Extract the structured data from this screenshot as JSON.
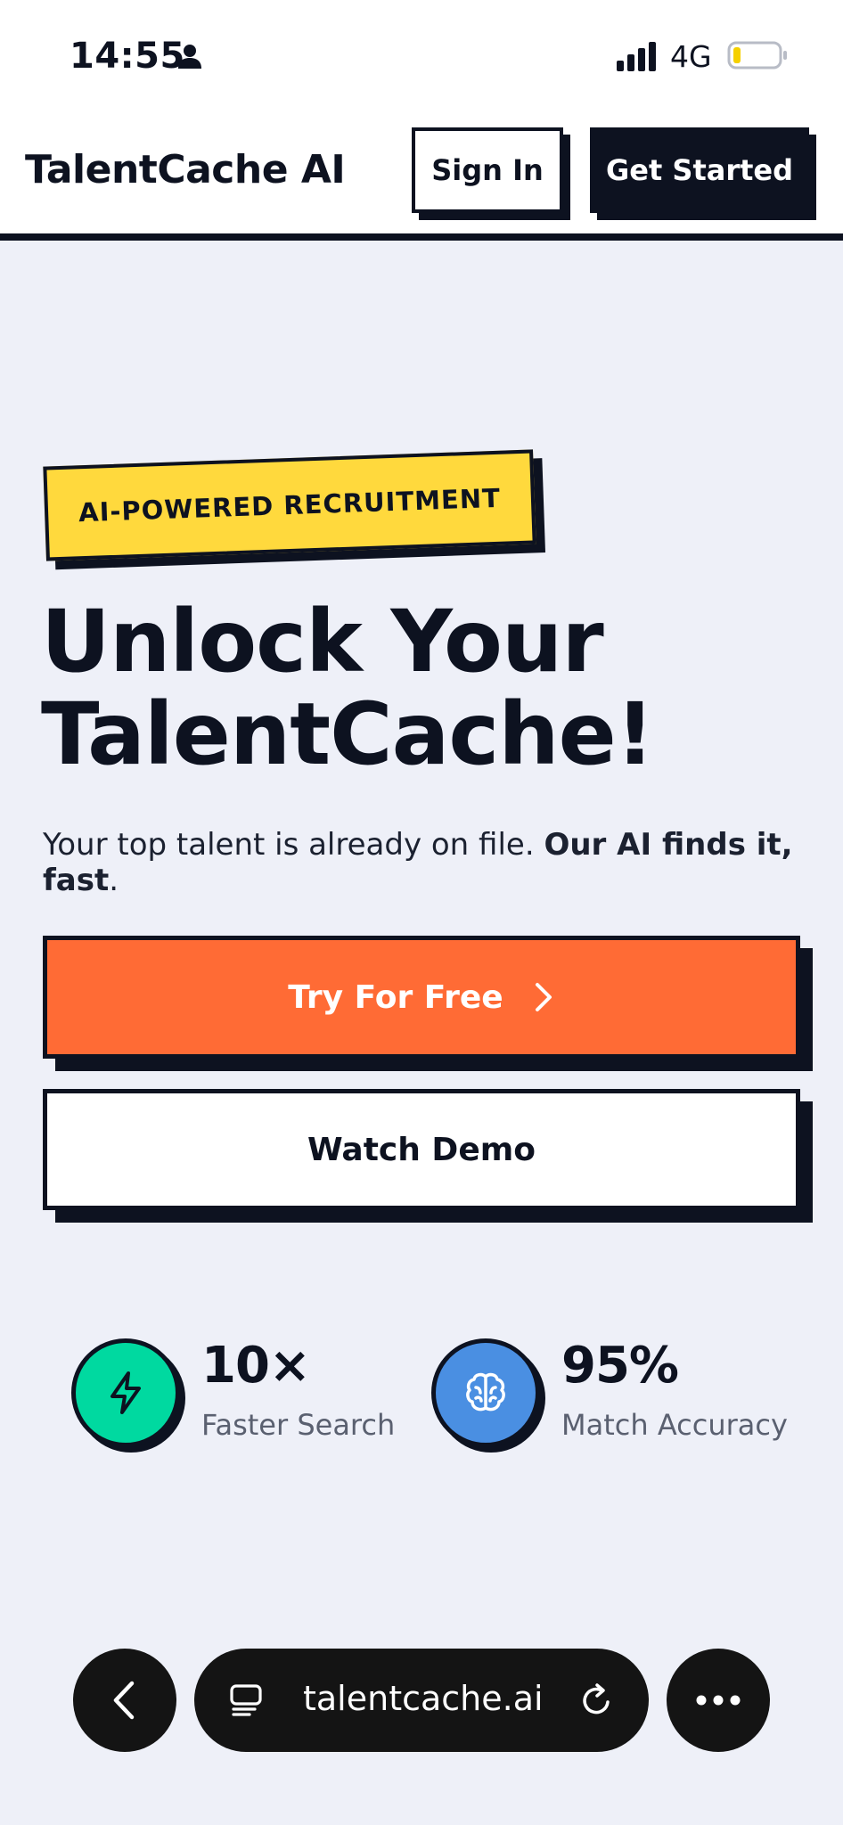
{
  "status_bar": {
    "time": "14:55",
    "network": "4G",
    "icons": [
      "person-icon",
      "signal-icon",
      "battery-icon"
    ]
  },
  "header": {
    "brand": "TalentCache AI",
    "sign_in_label": "Sign In",
    "get_started_label": "Get Started"
  },
  "hero": {
    "badge": "AI-POWERED RECRUITMENT",
    "title_line1": "Unlock Your",
    "title_line2": "TalentCache!",
    "subtitle_plain": "Your top talent is already on file. ",
    "subtitle_bold": "Our AI finds it, fast",
    "subtitle_end": ".",
    "try_label": "Try For Free",
    "demo_label": "Watch Demo"
  },
  "stats": [
    {
      "value": "10×",
      "label": "Faster Search",
      "icon": "lightning-icon",
      "color": "#00d9a0"
    },
    {
      "value": "95%",
      "label": "Match Accuracy",
      "icon": "brain-icon",
      "color": "#4a8fe2"
    }
  ],
  "browser": {
    "url": "talentcache.ai"
  },
  "colors": {
    "ink": "#0d1220",
    "accent_orange": "#ff6b35",
    "badge_yellow": "#ffd93d",
    "background": "#eef0f8"
  }
}
